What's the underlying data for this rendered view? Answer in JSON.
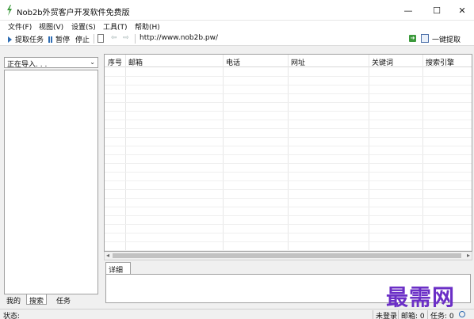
{
  "window": {
    "title": "Nob2b外贸客户开发软件免费版",
    "minimize": "—",
    "maximize": "☐",
    "close": "✕"
  },
  "menu": [
    "文件(F)",
    "视图(V)",
    "设置(S)",
    "工具(T)",
    "帮助(H)"
  ],
  "toolbar": {
    "start_label": "提取任务",
    "pause_label": "暂停",
    "stop_label": "停止",
    "back_arrow": "⇦",
    "forward_arrow": "⇨",
    "url": "http://www.nob2b.pw/",
    "one_click_label": "一键提取"
  },
  "left_panel": {
    "combo_value": "正在导入. . .",
    "tabs": [
      "我的",
      "搜索",
      "任务"
    ],
    "active_tab": "搜索"
  },
  "grid": {
    "columns": [
      "序号",
      "邮箱",
      "电话",
      "网址",
      "关键词",
      "搜索引擎"
    ],
    "rows": []
  },
  "detail": {
    "tab_label": "详细"
  },
  "watermark": "最需网",
  "statusbar": {
    "status_label": "状态:",
    "login_status": "未登录",
    "email_count": "邮箱: 0",
    "task_count": "任务: 0"
  },
  "colors": {
    "accent": "#2f6db3",
    "watermark": "#6b2fc6"
  }
}
